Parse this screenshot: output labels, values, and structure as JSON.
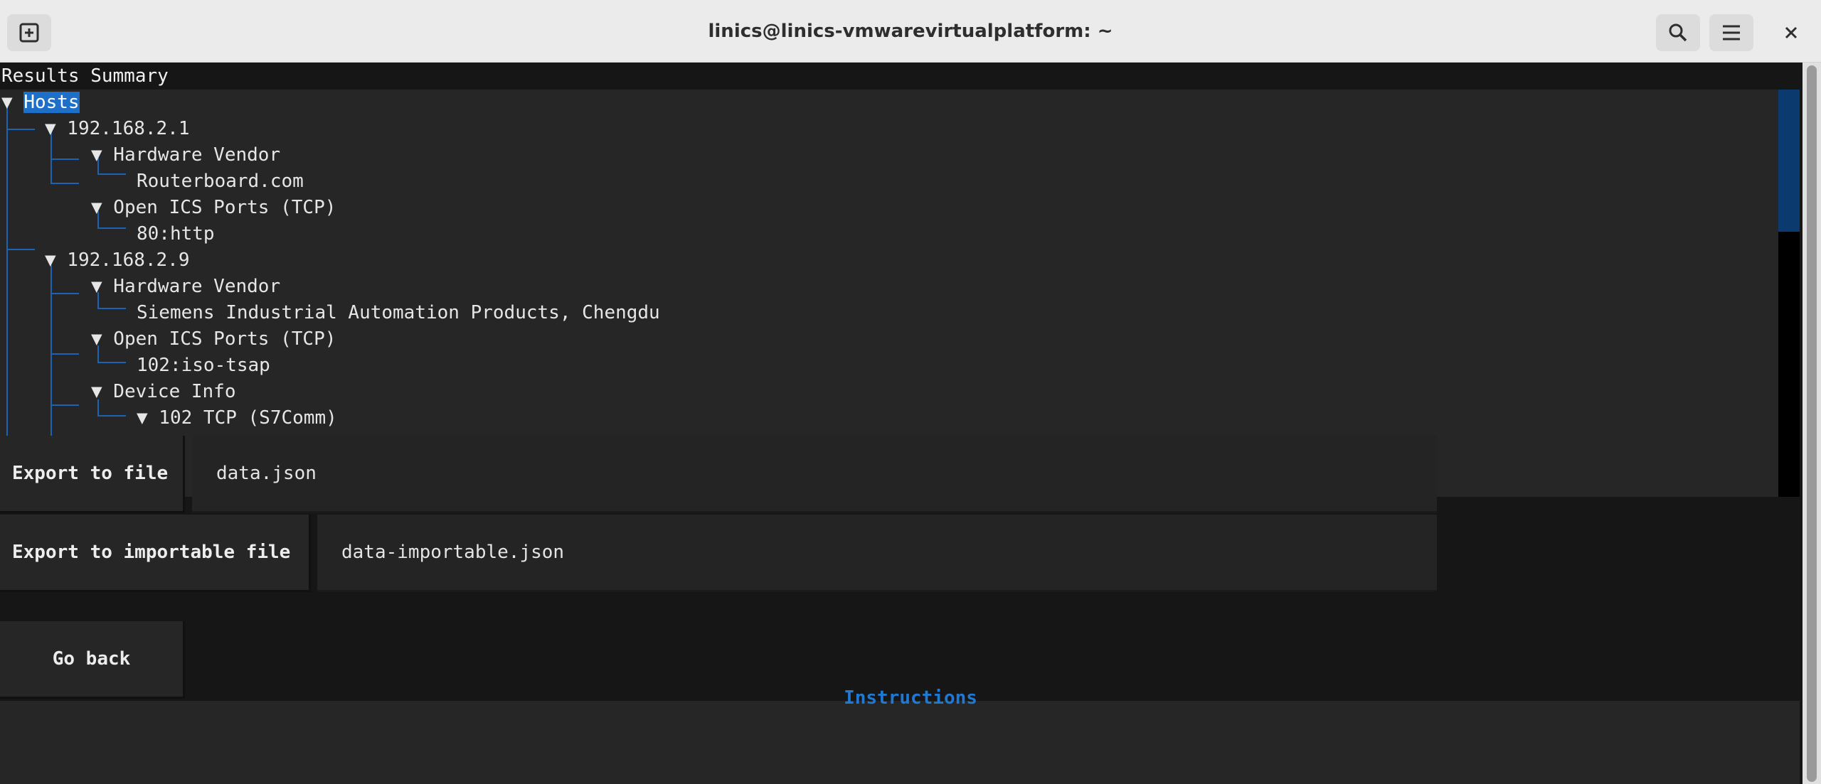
{
  "window": {
    "title": "linics@linics-vmwarevirtualplatform: ~",
    "new_tab_icon": "new-tab-icon",
    "search_icon": "search-icon",
    "menu_icon": "hamburger-menu-icon",
    "close_icon": "close-icon"
  },
  "results": {
    "heading": "Results Summary",
    "tree": [
      {
        "text": "▼ ",
        "label": "Hosts"
      },
      {
        "text": "▼ 192.168.2.1"
      },
      {
        "text": "▼ Hardware Vendor"
      },
      {
        "text": "Routerboard.com"
      },
      {
        "text": "▼ Open ICS Ports (TCP)"
      },
      {
        "text": "80:http"
      },
      {
        "text": "▼ 192.168.2.9"
      },
      {
        "text": "▼ Hardware Vendor"
      },
      {
        "text": "Siemens Industrial Automation Products, Chengdu"
      },
      {
        "text": "▼ Open ICS Ports (TCP)"
      },
      {
        "text": "102:iso-tsap"
      },
      {
        "text": "▼ Device Info"
      },
      {
        "text": "▼ 102 TCP (S7Comm)"
      }
    ]
  },
  "export": {
    "file_button": "Export to file",
    "file_value": "data.json",
    "importable_button": "Export to importable file",
    "importable_value": "data-importable.json"
  },
  "go_back": "Go back",
  "footer": {
    "instructions": "Instructions"
  },
  "colors": {
    "selection": "#1d6fc8",
    "tree_lines": "#1b64b3",
    "instructions": "#1f78d2"
  }
}
